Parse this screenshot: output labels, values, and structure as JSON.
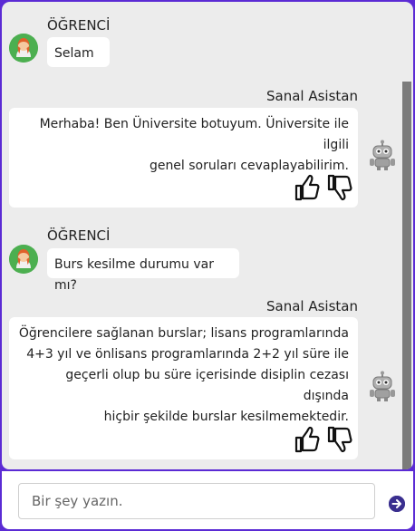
{
  "messages": [
    {
      "role": "user",
      "sender": "ÖĞRENCİ",
      "text": "Selam"
    },
    {
      "role": "bot",
      "sender": "Sanal Asistan",
      "lines": [
        "Merhaba! Ben Üniversite botuyum. Üniversite ile ilgili",
        "genel soruları cevaplayabilirim."
      ]
    },
    {
      "role": "user",
      "sender": "ÖĞRENCİ",
      "text": "Burs kesilme durumu var mı?"
    },
    {
      "role": "bot",
      "sender": "Sanal Asistan",
      "lines": [
        "Öğrencilere sağlanan burslar; lisans programlarında",
        "4+3 yıl ve önlisans programlarında 2+2 yıl süre ile",
        "geçerli olup bu süre içerisinde disiplin cezası dışında",
        "hiçbir şekilde burslar kesilmemektedir."
      ]
    }
  ],
  "input": {
    "placeholder": "Bir şey yazın."
  },
  "icons": {
    "user_avatar": "student-avatar-icon",
    "bot_avatar": "robot-icon",
    "like": "thumbs-up-icon",
    "dislike": "thumbs-down-icon",
    "send": "send-arrow-icon"
  },
  "colors": {
    "accent": "#5b2bd4",
    "chat_bg": "#ececec",
    "avatar_bg": "#4caf50",
    "send": "#3a2f8f"
  }
}
